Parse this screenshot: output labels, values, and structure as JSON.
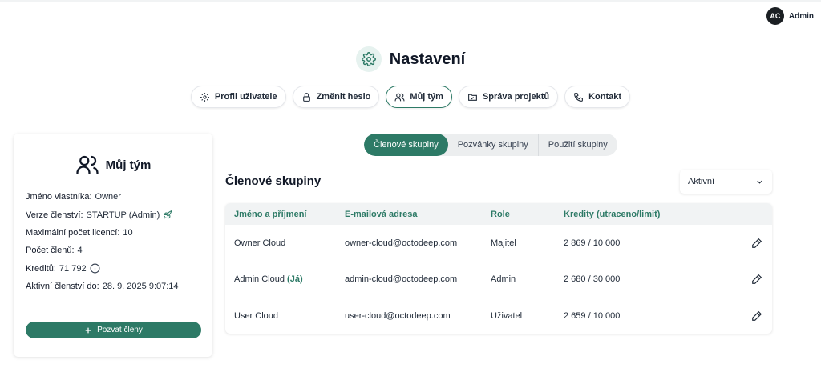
{
  "user": {
    "initials": "AC",
    "name": "Admin"
  },
  "page": {
    "title": "Nastavení",
    "icon": "gear-icon"
  },
  "nav_tabs": [
    {
      "label": "Profil uživatele",
      "icon": "gear-icon"
    },
    {
      "label": "Změnit heslo",
      "icon": "lock-icon"
    },
    {
      "label": "Můj tým",
      "icon": "users-icon",
      "active": true
    },
    {
      "label": "Správa projektů",
      "icon": "folder-icon"
    },
    {
      "label": "Kontakt",
      "icon": "phone-icon"
    }
  ],
  "team_card": {
    "title": "Můj tým",
    "owner_label": "Jméno vlastníka:",
    "owner_value": "Owner",
    "membership_label": "Verze členství:",
    "membership_value": "STARTUP (Admin)",
    "licenses_label": "Maximální počet licencí:",
    "licenses_value": "10",
    "members_label": "Počet členů:",
    "members_value": "4",
    "credits_label": "Kreditů:",
    "credits_value": "71 792",
    "active_label": "Aktivní členství do:",
    "active_value": "28. 9. 2025 9:07:14",
    "invite_label": "Pozvat členy"
  },
  "segment_tabs": [
    {
      "label": "Členové skupiny",
      "active": true
    },
    {
      "label": "Pozvánky skupiny"
    },
    {
      "label": "Použití skupiny"
    }
  ],
  "section": {
    "title": "Členové skupiny",
    "filter_value": "Aktivní"
  },
  "table": {
    "headers": [
      "Jméno a příjmení",
      "E-mailová adresa",
      "Role",
      "Kredity (utraceno/limit)"
    ],
    "rows": [
      {
        "name": "Owner Cloud",
        "me": "",
        "email": "owner-cloud@octodeep.com",
        "role": "Majitel",
        "credits": "2 869 / 10 000"
      },
      {
        "name": "Admin Cloud",
        "me": "(Já)",
        "email": "admin-cloud@octodeep.com",
        "role": "Admin",
        "credits": "2 680 / 30 000"
      },
      {
        "name": "User Cloud",
        "me": "",
        "email": "user-cloud@octodeep.com",
        "role": "Uživatel",
        "credits": "2 659 / 10 000"
      }
    ]
  },
  "colors": {
    "accent": "#2d7a66",
    "accent_light": "#e6f2ef"
  }
}
